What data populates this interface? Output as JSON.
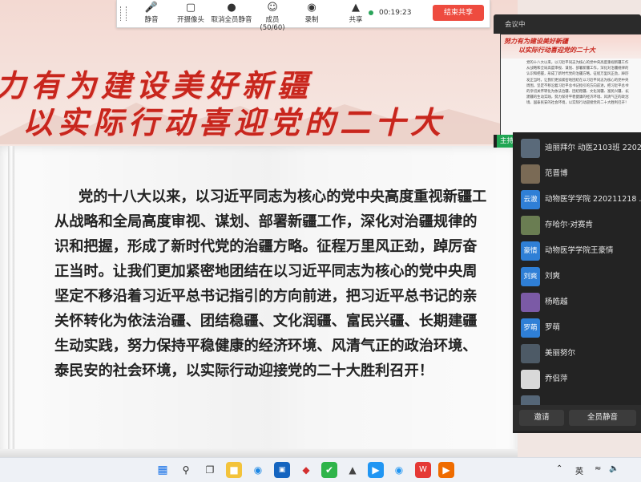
{
  "slide": {
    "banner_line1": "力有为建设美好新疆",
    "banner_line2": "以实际行动喜迎党的二十大",
    "body_lines": [
      "党的十八大以来，以习近平同志为核心的党中央高度重视新疆工",
      "从战略和全局高度审视、谋划、部署新疆工作，深化对治疆规律的",
      "识和把握，形成了新时代党的治疆方略。征程万里风正劲，踔厉奋",
      "正当时。让我们更加紧密地团结在以习近平同志为核心的党中央周",
      "坚定不移沿着习近平总书记指引的方向前进，把习近平总书记的亲",
      "关怀转化为依法治疆、团结稳疆、文化润疆、富民兴疆、长期建疆",
      "生动实践，努力保持平稳健康的经济环境、风清气正的政治环境、",
      "泰民安的社会环境，以实际行动迎接党的二十大胜利召开！"
    ]
  },
  "toolbar": {
    "buttons": [
      {
        "label": "静音",
        "icon": "microphone-icon"
      },
      {
        "label": "开摄像头",
        "icon": "camera-off-icon"
      },
      {
        "label": "取消全员静音",
        "icon": "unmute-all-icon"
      },
      {
        "label": "成员(50/60)",
        "icon": "members-icon"
      },
      {
        "label": "录制",
        "icon": "record-icon"
      },
      {
        "label": "共享",
        "icon": "share-screen-icon"
      }
    ],
    "timer": "00:19:23",
    "end_share_label": "结束共享",
    "status_color": "#2aa45a",
    "end_color": "#ee4b3f"
  },
  "panel": {
    "status": "会议中",
    "thumb_title1": "努力有为建设美好新疆",
    "thumb_title2": "以实际行动喜迎党的二十大",
    "thumb_lines": [
      "党的十八大以来，以习近平同志为核心的党中央高度重视新疆工作，",
      "从战略和全局高度审视、谋划、部署新疆工作，深化对治疆规律的",
      "认识和把握，形成了新时代党的治疆方略。征程万里风正劲，踔厉奋",
      "发正当时。让我们更加紧密地团结在以习近平同志为核心的党中央",
      "周围，坚定不移沿着习近平总书记指引的方向前进，把习近平总书记",
      "的亲切关怀转化为依法治疆、团结稳疆、文化润疆、富民兴疆、长期",
      "建疆的生动实践，努力保持平稳健康的经济环境、风清气正的政治环",
      "境、国泰民安的社会环境，以实际行动迎接党的二十大胜利召开！"
    ],
    "host_label": "主持人",
    "me_label": "我",
    "participants": [
      {
        "avatar_text": "",
        "name": "迪丽拜尔 动医2103班 2202...",
        "color": "#5a6a7a"
      },
      {
        "avatar_text": "",
        "name": "范晋博",
        "color": "#7a6a55"
      },
      {
        "avatar_text": "云澈",
        "name": "动物医学学院 220211218 ...",
        "color": "#2f7fd6"
      },
      {
        "avatar_text": "",
        "name": "存哈尔·对赛肯",
        "color": "#6a7d52"
      },
      {
        "avatar_text": "豪情",
        "name": "动物医学学院王豪情",
        "color": "#2f7fd6"
      },
      {
        "avatar_text": "刘爽",
        "name": "刘爽",
        "color": "#2f7fd6"
      },
      {
        "avatar_text": "",
        "name": "杨皓越",
        "color": "#7b5aa6"
      },
      {
        "avatar_text": "罗萌",
        "name": "罗萌",
        "color": "#2f7fd6"
      },
      {
        "avatar_text": "",
        "name": "美丽努尔",
        "color": "#4d5a66"
      },
      {
        "avatar_text": "",
        "name": "乔侣萍",
        "color": "#d9d9d9"
      },
      {
        "avatar_text": "",
        "name": "...",
        "color": "#556677"
      }
    ],
    "invite_label": "邀请",
    "mute_all_label": "全员静音"
  },
  "taskbar": {
    "apps": [
      "windows-start-icon",
      "search-icon",
      "task-view-icon",
      "file-explorer-icon",
      "edge-browser-icon",
      "store-icon",
      "app-icon",
      "wechat-icon",
      "app-icon",
      "app-icon",
      "app-icon",
      "wps-icon",
      "media-icon"
    ],
    "ime": "英"
  }
}
